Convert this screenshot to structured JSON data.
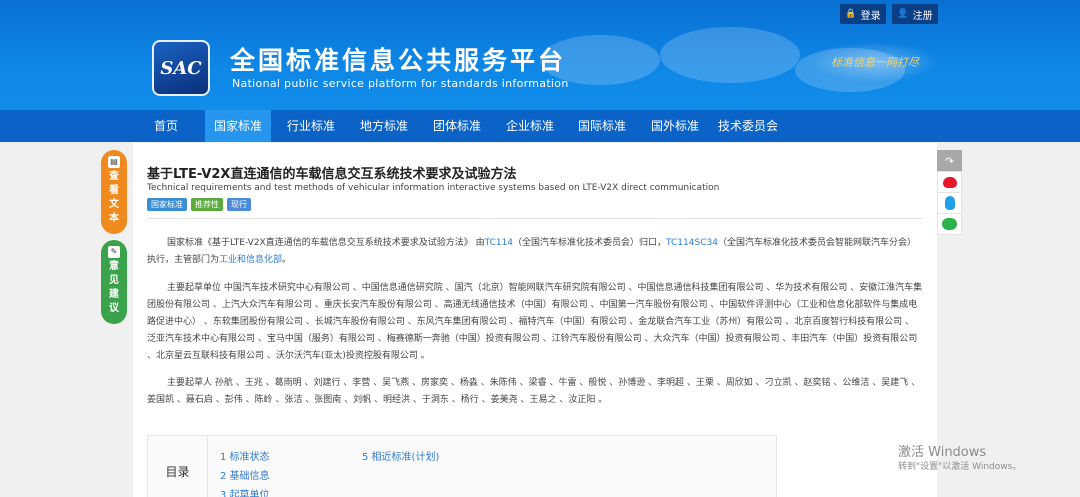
{
  "top_bar": {
    "login_label": "登录",
    "register_label": "注册"
  },
  "brand": {
    "logo_text": "SAC",
    "title": "全国标准信息公共服务平台",
    "subtitle": "National public service platform  for standards information",
    "slogan": "标准信息一网打尽"
  },
  "nav": {
    "items": [
      {
        "label": "首页"
      },
      {
        "label": "国家标准"
      },
      {
        "label": "行业标准"
      },
      {
        "label": "地方标准"
      },
      {
        "label": "团体标准"
      },
      {
        "label": "企业标准"
      },
      {
        "label": "国际标准"
      },
      {
        "label": "国外标准"
      },
      {
        "label": "技术委员会"
      }
    ],
    "active_index": 1
  },
  "floating": {
    "view_text_label": "查看文本",
    "suggest_label": "意见建议"
  },
  "standard": {
    "title": "基于LTE-V2X直连通信的车载信息交互系统技术要求及试验方法",
    "title_en": "Technical requirements and test methods of vehicular information interactive systems based on LTE-V2X direct communication",
    "tags": [
      "国家标准",
      "推荐性",
      "现行"
    ],
    "para1": {
      "prefix": "国家标准《基于LTE-V2X直连通信的车载信息交互系统技术要求及试验方法》 由",
      "tc1": "TC114",
      "mid1": "（全国汽车标准化技术委员会）归口，",
      "tc2": "TC114SC34",
      "mid2": "（全国汽车标准化技术委员会智能网联汽车分会）执行，主管部门为",
      "dept": "工业和信息化部",
      "suffix": "。"
    },
    "para2": "主要起草单位 中国汽车技术研究中心有限公司 、中国信息通信研究院 、国汽（北京）智能网联汽车研究院有限公司 、中国信息通信科技集团有限公司 、华为技术有限公司 、安徽江淮汽车集团股份有限公司 、上汽大众汽车有限公司 、重庆长安汽车股份有限公司 、高通无线通信技术（中国）有限公司 、中国第一汽车股份有限公司 、中国软件评测中心（工业和信息化部软件与集成电路促进中心） 、东软集团股份有限公司 、长城汽车股份有限公司 、东风汽车集团有限公司 、福特汽车（中国）有限公司 、金龙联合汽车工业（苏州）有限公司 、北京百度智行科技有限公司 、泛亚汽车技术中心有限公司 、宝马中国（服务）有限公司 、梅赛德斯一奔驰（中国）投资有限公司 、江铃汽车股份有限公司 、大众汽车（中国）投资有限公司 、丰田汽车（中国）投资有限公司 、北京星云互联科技有限公司 、沃尔沃汽车(亚太)投资控股有限公司 。",
    "para3": "主要起草人 孙航 、王兆 、葛雨明 、刘建行 、李营 、吴飞燕 、房家奕 、杨淼 、朱陈伟 、梁睿 、牛雷 、般悦 、孙博逊 、李明超 、王栗 、周欣如 、刁立凯 、赵奕铭 、公维洁 、吴建飞 、姜国凯 、聂石启 、彭伟 、陈岭 、张洁 、张图南 、刘帆 、明经洪 、于洞东 、杨行 、姜美尧 、王易之 、汝正阳 。"
  },
  "toc": {
    "label": "目录",
    "items": [
      "1 标准状态",
      "2 基础信息",
      "3 起草单位",
      "5 相近标准(计划)"
    ]
  },
  "windows_watermark": {
    "title": "激活 Windows",
    "subtitle": "转到\"设置\"以激活 Windows。"
  }
}
